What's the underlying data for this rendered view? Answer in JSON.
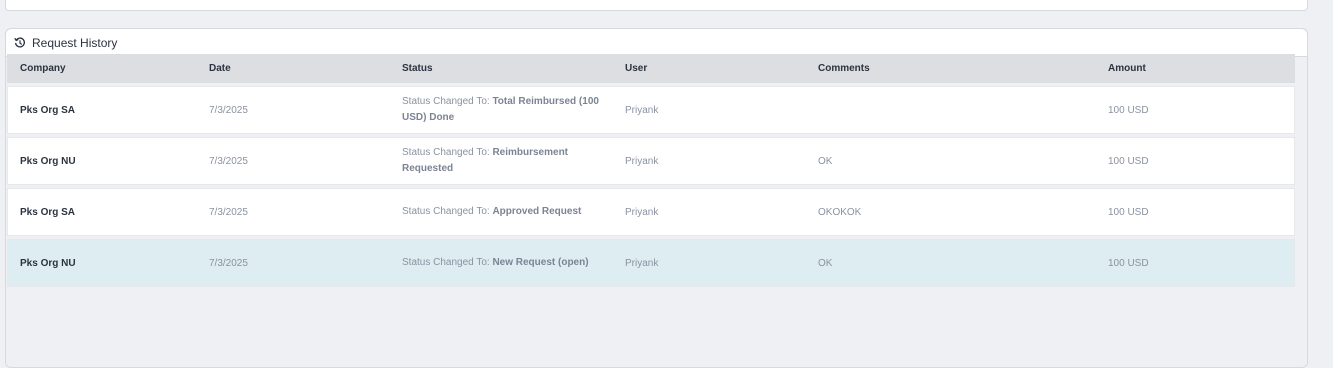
{
  "panel": {
    "title": "Request History"
  },
  "table": {
    "headers": {
      "company": "Company",
      "date": "Date",
      "status": "Status",
      "user": "User",
      "comments": "Comments",
      "amount": "Amount"
    },
    "rows": [
      {
        "company": "Pks Org SA",
        "date": "7/3/2025",
        "status_prefix": "Status Changed To: ",
        "status_value": "Total Reimbursed (100 USD) Done",
        "user": "Priyank",
        "comments": "",
        "amount": "100 USD"
      },
      {
        "company": "Pks Org NU",
        "date": "7/3/2025",
        "status_prefix": "Status Changed To: ",
        "status_value": "Reimbursement Requested",
        "user": "Priyank",
        "comments": "OK",
        "amount": "100 USD"
      },
      {
        "company": "Pks Org SA",
        "date": "7/3/2025",
        "status_prefix": "Status Changed To: ",
        "status_value": "Approved Request",
        "user": "Priyank",
        "comments": "OKOKOK",
        "amount": "100 USD"
      },
      {
        "company": "Pks Org NU",
        "date": "7/3/2025",
        "status_prefix": "Status Changed To: ",
        "status_value": "New Request (open)",
        "user": "Priyank",
        "comments": "OK",
        "amount": "100 USD"
      }
    ]
  }
}
